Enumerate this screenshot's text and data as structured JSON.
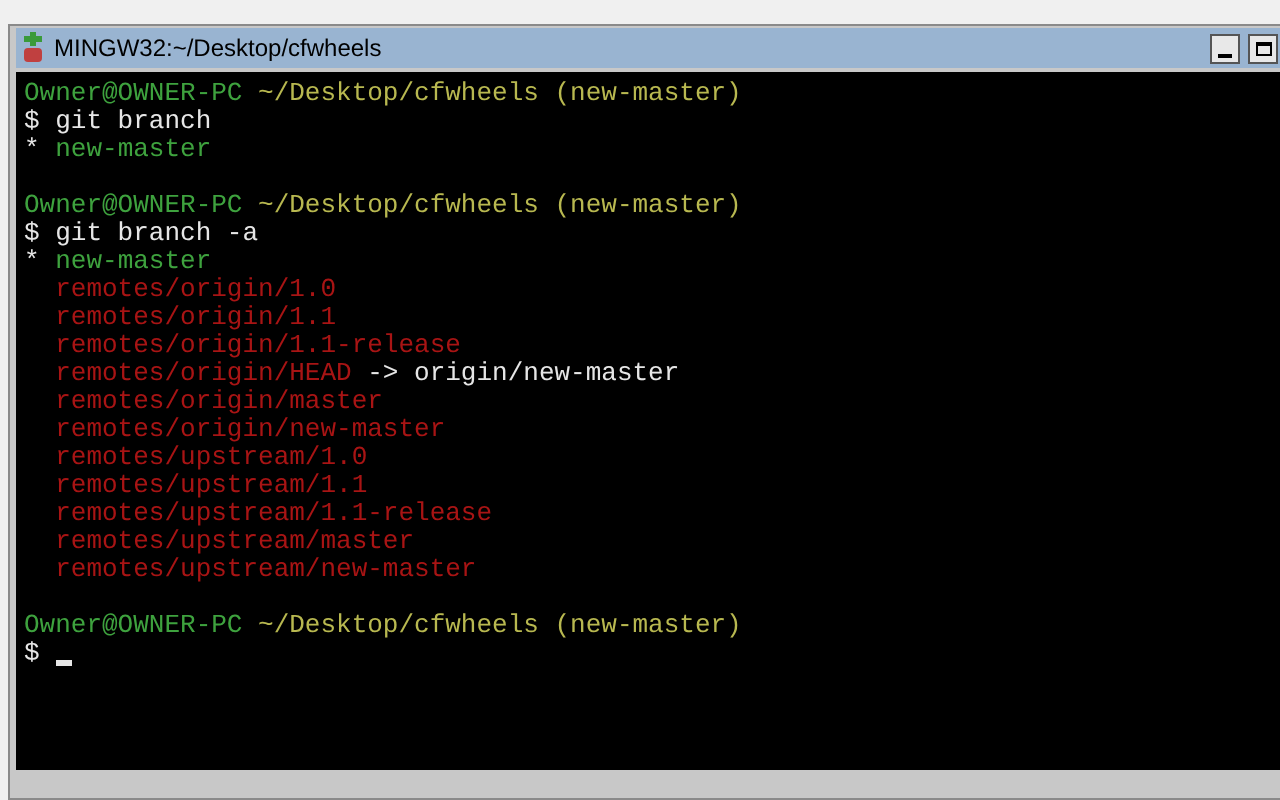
{
  "window": {
    "title": "MINGW32:~/Desktop/cfwheels"
  },
  "terminal": {
    "lines": [
      {
        "kind": "text",
        "segments": [
          {
            "text": "Owner@OWNER-PC",
            "kind": "user"
          },
          {
            "text": " ~/Desktop/cfwheels (new-master)",
            "kind": "path"
          }
        ]
      },
      {
        "kind": "text",
        "segments": [
          {
            "text": "$ git branch",
            "kind": "plain"
          }
        ]
      },
      {
        "kind": "text",
        "segments": [
          {
            "text": "* ",
            "kind": "plain"
          },
          {
            "text": "new-master",
            "kind": "current"
          }
        ]
      },
      {
        "kind": "blank"
      },
      {
        "kind": "text",
        "segments": [
          {
            "text": "Owner@OWNER-PC",
            "kind": "user"
          },
          {
            "text": " ~/Desktop/cfwheels (new-master)",
            "kind": "path"
          }
        ]
      },
      {
        "kind": "text",
        "segments": [
          {
            "text": "$ git branch -a",
            "kind": "plain"
          }
        ]
      },
      {
        "kind": "text",
        "segments": [
          {
            "text": "* ",
            "kind": "plain"
          },
          {
            "text": "new-master",
            "kind": "current"
          }
        ]
      },
      {
        "kind": "text",
        "segments": [
          {
            "text": "  remotes/origin/1.0",
            "kind": "remote"
          }
        ]
      },
      {
        "kind": "text",
        "segments": [
          {
            "text": "  remotes/origin/1.1",
            "kind": "remote"
          }
        ]
      },
      {
        "kind": "text",
        "segments": [
          {
            "text": "  remotes/origin/1.1-release",
            "kind": "remote"
          }
        ]
      },
      {
        "kind": "text",
        "segments": [
          {
            "text": "  remotes/origin/HEAD",
            "kind": "remote"
          },
          {
            "text": " -> origin/new-master",
            "kind": "plain"
          }
        ]
      },
      {
        "kind": "text",
        "segments": [
          {
            "text": "  remotes/origin/master",
            "kind": "remote"
          }
        ]
      },
      {
        "kind": "text",
        "segments": [
          {
            "text": "  remotes/origin/new-master",
            "kind": "remote"
          }
        ]
      },
      {
        "kind": "text",
        "segments": [
          {
            "text": "  remotes/upstream/1.0",
            "kind": "remote"
          }
        ]
      },
      {
        "kind": "text",
        "segments": [
          {
            "text": "  remotes/upstream/1.1",
            "kind": "remote"
          }
        ]
      },
      {
        "kind": "text",
        "segments": [
          {
            "text": "  remotes/upstream/1.1-release",
            "kind": "remote"
          }
        ]
      },
      {
        "kind": "text",
        "segments": [
          {
            "text": "  remotes/upstream/master",
            "kind": "remote"
          }
        ]
      },
      {
        "kind": "text",
        "segments": [
          {
            "text": "  remotes/upstream/new-master",
            "kind": "remote"
          }
        ]
      },
      {
        "kind": "blank"
      },
      {
        "kind": "text",
        "segments": [
          {
            "text": "Owner@OWNER-PC",
            "kind": "user"
          },
          {
            "text": " ~/Desktop/cfwheels (new-master)",
            "kind": "path"
          }
        ]
      },
      {
        "kind": "prompt",
        "segments": [
          {
            "text": "$ ",
            "kind": "plain"
          }
        ]
      }
    ]
  }
}
